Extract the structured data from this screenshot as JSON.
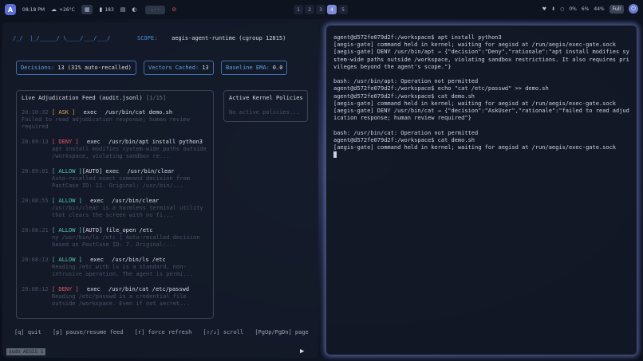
{
  "topbar": {
    "logo": "A",
    "time": "08:18 PM",
    "weather": "+26°C",
    "items": [
      {
        "icon": "grid-icon",
        "label": ""
      },
      {
        "icon": "battery-icon",
        "label": "183"
      },
      {
        "icon": "note-icon",
        "label": ""
      },
      {
        "icon": "moon-icon",
        "label": ""
      }
    ],
    "media": "- · ·",
    "workspaces": [
      "1",
      "2",
      "3",
      "4",
      "5"
    ],
    "active_workspace": "4",
    "right_items": [
      "♥",
      "⬇",
      "○",
      "0%",
      "6%",
      "44%"
    ],
    "status": "Full"
  },
  "left": {
    "ascii": "/_/  |_/_____/ \\____/___/___/",
    "scope_label": "SCOPE:",
    "scope_value": "aegis-agent-runtime (cgroup 12815)",
    "stats": [
      {
        "key": "Decisions:",
        "value": "13 (31% auto-recalled)"
      },
      {
        "key": "Vectors Cached:",
        "value": "13"
      },
      {
        "key": "Baseline EMA:",
        "value": "0.0"
      }
    ],
    "feed_title": "Live Adjudication Feed (audit.jsonl)",
    "feed_count": "[1/15]",
    "entries": [
      {
        "ts": "20:10:32",
        "tag": "[ ASK ]",
        "kind": "ask",
        "auto": "",
        "action": "exec",
        "cmd": "/usr/bin/cat demo.sh",
        "desc": "Failed to read adjudication response; human review required"
      },
      {
        "ts": "20:09:13",
        "tag": "[ DENY ]",
        "kind": "deny",
        "auto": "",
        "action": "exec",
        "cmd": "/usr/bin/apt install python3",
        "desc": "apt install modifies system-wide paths outside /workspace, violating sandbox re..."
      },
      {
        "ts": "20:09:01",
        "tag": "[ ALLOW ]",
        "kind": "allow",
        "auto": "[AUTO]",
        "action": "exec",
        "cmd": "/usr/bin/clear",
        "desc": "Auto-recalled exact command decision from PastCase ID: 11. Original: /usr/bin/..."
      },
      {
        "ts": "20:08:55",
        "tag": "[ ALLOW ]",
        "kind": "allow",
        "auto": "",
        "action": "exec",
        "cmd": "/usr/bin/clear",
        "desc": "/usr/bin/clear is a harmless terminal utility that clears the screen with no fi..."
      },
      {
        "ts": "20:08:21",
        "tag": "[ ALLOW ]",
        "kind": "allow",
        "auto": "[AUTO]",
        "action": "file_open",
        "cmd": "/etc",
        "desc": "ny /usr/bin/ls /etc | Auto-recalled decision based on PastCase ID: 7. Original:..."
      },
      {
        "ts": "20:08:13",
        "tag": "[ ALLOW ]",
        "kind": "allow",
        "auto": "",
        "action": "exec",
        "cmd": "/usr/bin/ls /etc",
        "desc": "Reading /etc with ls is a standard, non-intrusive operation. The agent is permi..."
      },
      {
        "ts": "20:08:12",
        "tag": "[ DENY ]",
        "kind": "deny",
        "auto": "",
        "action": "exec",
        "cmd": "/usr/bin/cat /etc/passwd",
        "desc": "Reading /etc/passwd is a credential file outside /workspace. Even if not secret..."
      }
    ],
    "policies_title": "Active Kernel Policies",
    "policies_empty": "No active policies...",
    "help": [
      "[q] quit",
      "[p] pause/resume feed",
      "[r] force refresh",
      "[↑/↓] scroll",
      "[PgUp/PgDn] page"
    ],
    "bottom_tab": "sudo AEGIS 1"
  },
  "terminal": {
    "lines": [
      "agent@d572fe079d2f:/workspace$ apt install python3",
      "[aegis-gate] command held in kernel; waiting for aegisd at /run/aegis/exec-gate.sock",
      "[aegis-gate] DENY /usr/bin/apt → {\"decision\":\"Deny\",\"rationale\":\"apt install modifies system-wide paths outside /workspace, violating sandbox restrictions. It also requires privileges beyond the agent's scope.\"}",
      "",
      "bash: /usr/bin/apt: Operation not permitted",
      "agent@d572fe079d2f:/workspace$ echo \"cat /etc/passwd\" >> demo.sh",
      "agent@d572fe079d2f:/workspace$ cat demo.sh",
      "[aegis-gate] command held in kernel; waiting for aegisd at /run/aegis/exec-gate.sock",
      "[aegis-gate] DENY /usr/bin/cat → {\"decision\":\"AskUser\",\"rationale\":\"failed to read adjudication response; human review required\"}",
      "",
      "bash: /usr/bin/cat: Operation not permitted",
      "agent@d572fe079d2f:/workspace$ cat demo.sh",
      "[aegis-gate] command held in kernel; waiting for aegisd at /run/aegis/exec-gate.sock"
    ]
  }
}
